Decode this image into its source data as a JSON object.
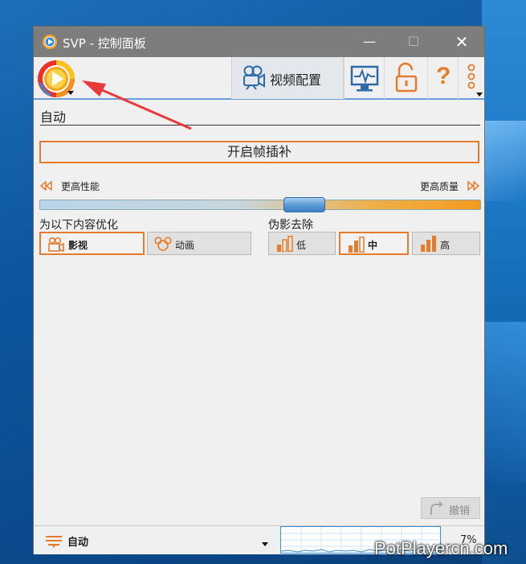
{
  "window": {
    "title": "SVP - 控制面板"
  },
  "titlebar": {
    "min_glyph": "—",
    "max_glyph": "☐",
    "close_glyph": "✕"
  },
  "toolbar": {
    "logo_icon": "svp-logo-icon",
    "tab_video_label": "视频配置",
    "icons": [
      "camera-icon",
      "monitor-icon",
      "unlock-icon",
      "help-icon",
      "more-vertical-icon"
    ],
    "help_glyph": "?"
  },
  "mode": {
    "label": "自动"
  },
  "interp_button": {
    "label": "开启帧插补"
  },
  "quality": {
    "left_label": "更高性能",
    "right_label": "更高质量",
    "level_fraction": 0.6
  },
  "optimize": {
    "label": "为以下内容优化",
    "options": [
      {
        "label": "影视",
        "icon": "film-camera-icon",
        "selected": true
      },
      {
        "label": "动画",
        "icon": "mouse-head-icon",
        "selected": false
      }
    ]
  },
  "artifact": {
    "label": "伪影去除",
    "options": [
      {
        "label": "低",
        "icon": "bars-low-icon",
        "selected": false
      },
      {
        "label": "中",
        "icon": "bars-mid-icon",
        "selected": true
      },
      {
        "label": "高",
        "icon": "bars-high-icon",
        "selected": false
      }
    ]
  },
  "undo": {
    "label": "撤销"
  },
  "status": {
    "profile": "自动",
    "cpu": "7%"
  },
  "watermark": "PotPlayercn.com",
  "colors": {
    "accent": "#e57c2b",
    "titlebar": "#7d7d7d",
    "window": "#f0f0f0",
    "annotation": "#e83a3a"
  }
}
